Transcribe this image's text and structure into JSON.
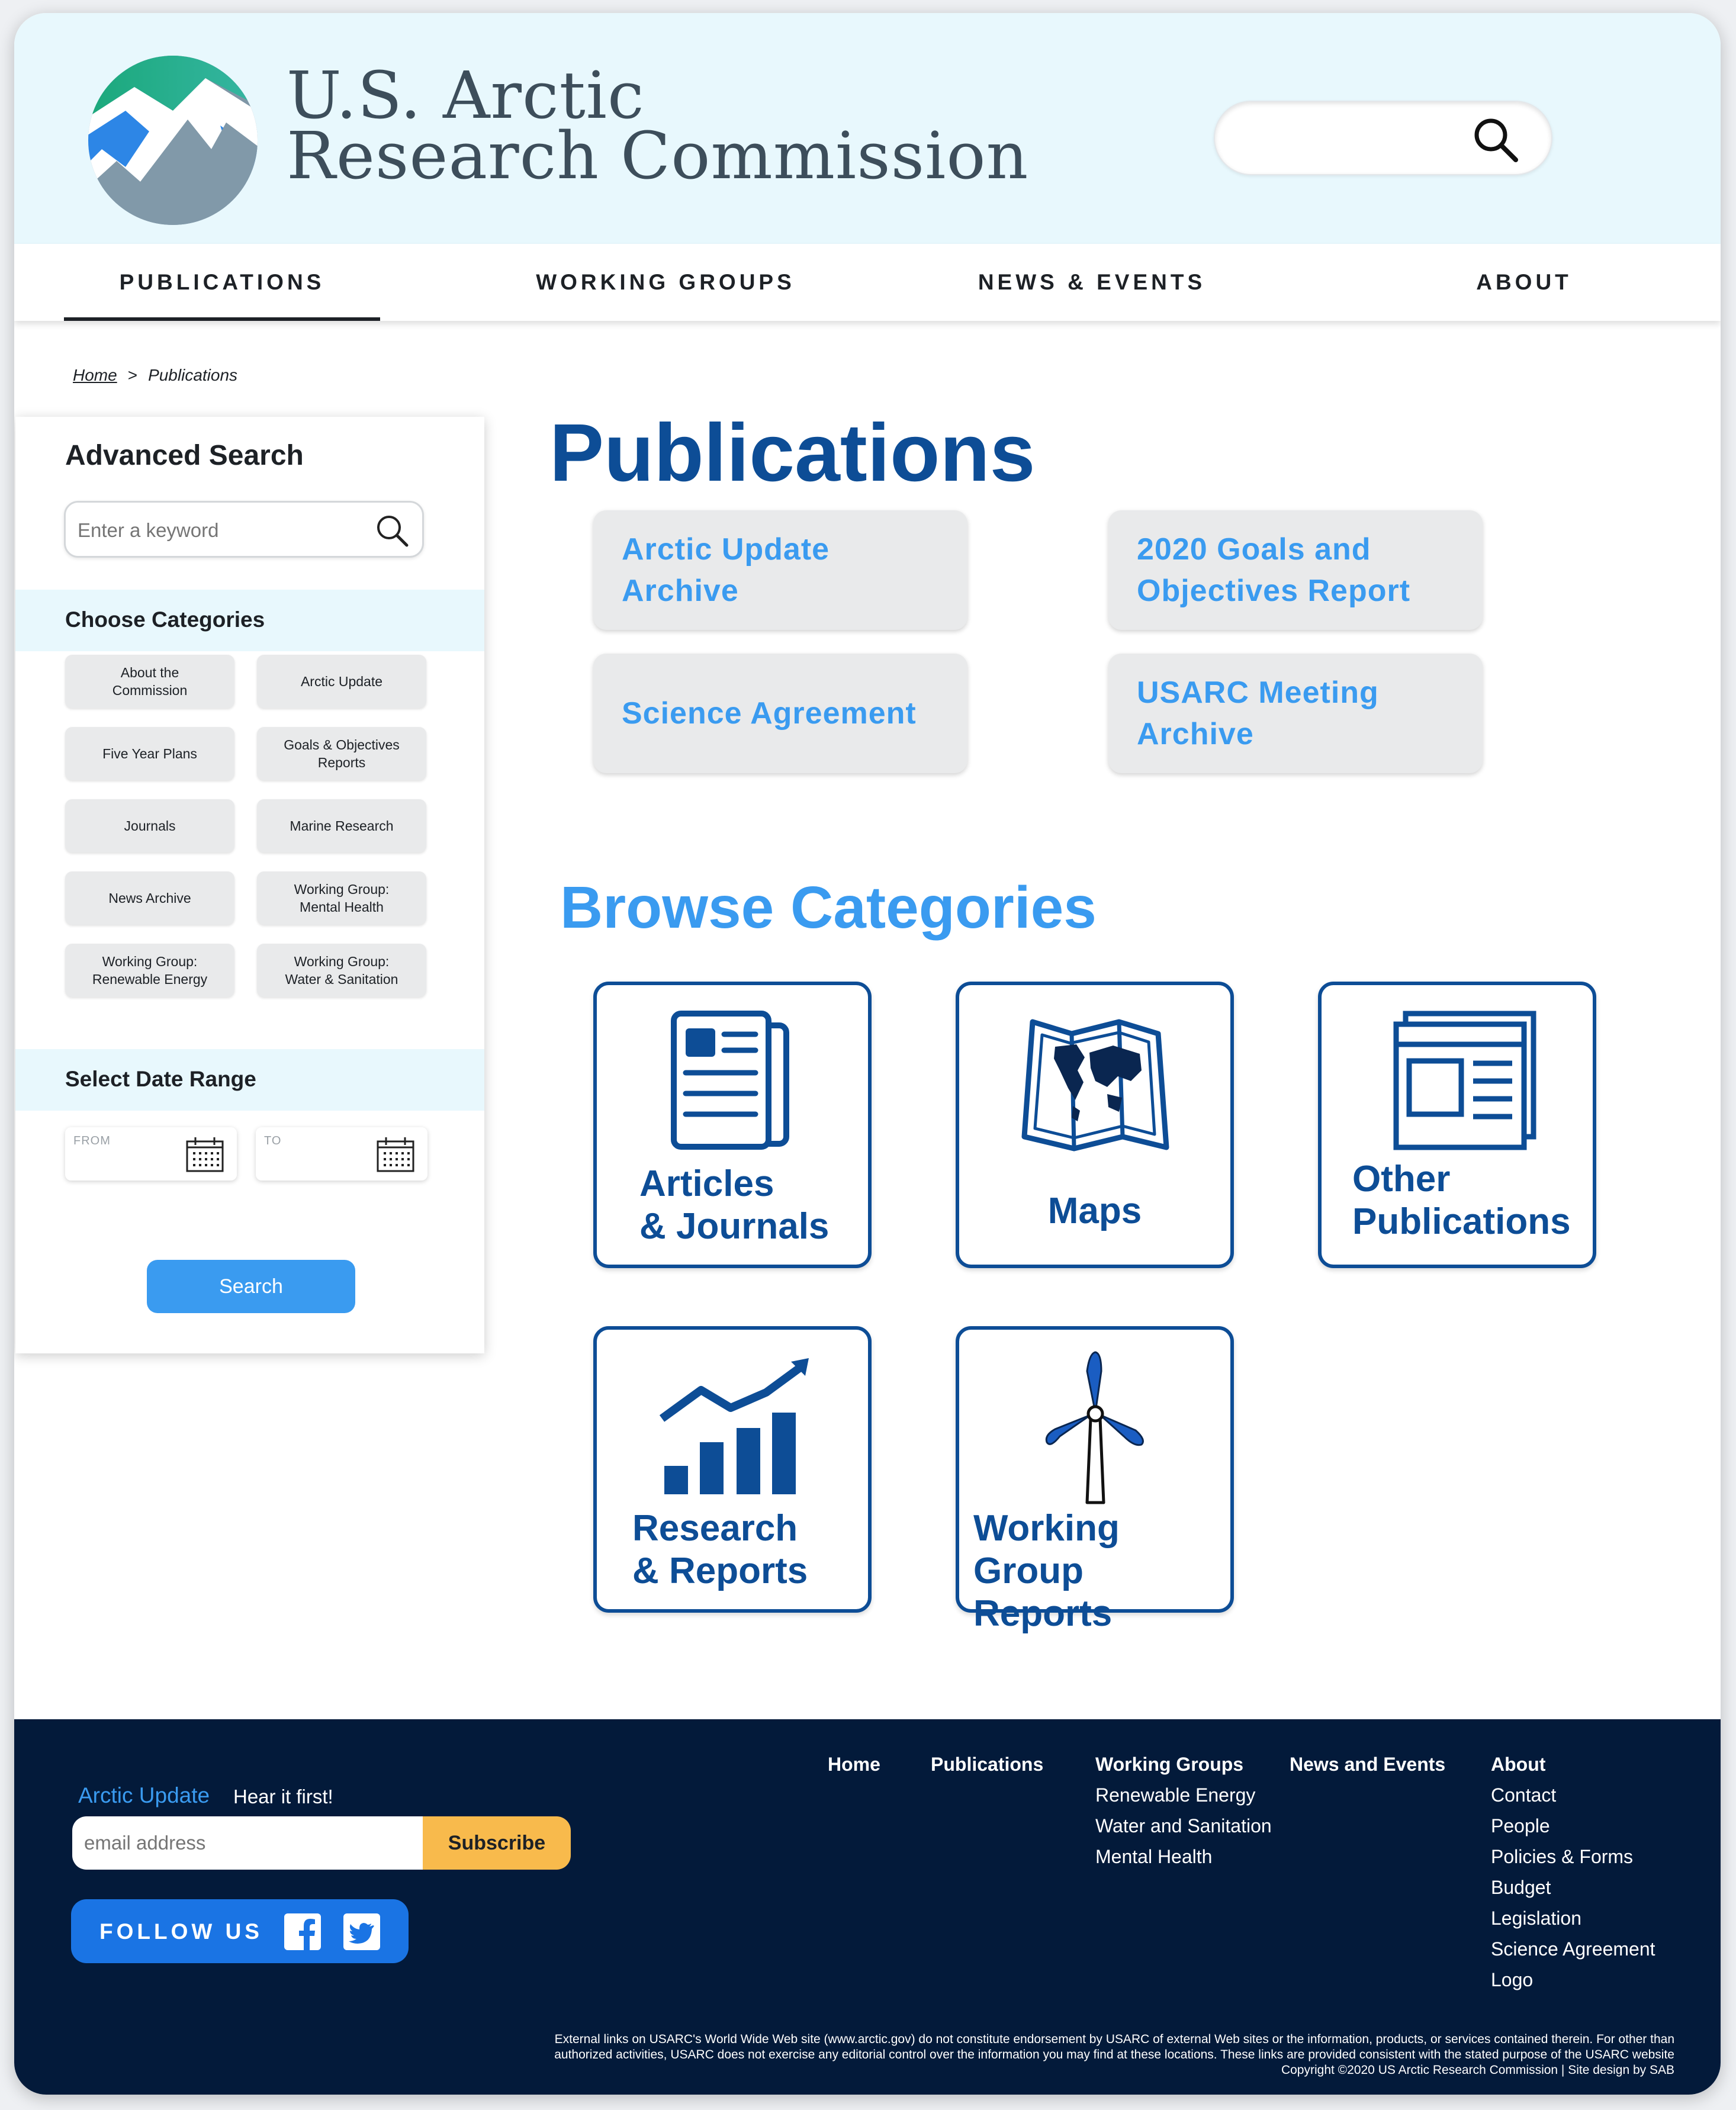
{
  "header": {
    "title_line1": "U.S. Arctic",
    "title_line2": "Research Commission",
    "search_placeholder": ""
  },
  "nav": {
    "items": [
      "PUBLICATIONS",
      "WORKING GROUPS",
      "NEWS & EVENTS",
      "ABOUT"
    ],
    "active": "PUBLICATIONS"
  },
  "breadcrumb": {
    "home": "Home",
    "separator": ">",
    "current": "Publications"
  },
  "sidebar": {
    "title": "Advanced Search",
    "keyword_placeholder": "Enter a keyword",
    "categories_title": "Choose Categories",
    "categories": [
      "About the\nCommission",
      "Arctic Update",
      "Five Year Plans",
      "Goals & Objectives\nReports",
      "Journals",
      "Marine Research",
      "News Archive",
      "Working Group:\nMental Health",
      "Working Group:\nRenewable Energy",
      "Working Group:\nWater & Sanitation"
    ],
    "date_title": "Select Date Range",
    "from_label": "FROM",
    "to_label": "TO",
    "search_label": "Search"
  },
  "main": {
    "title": "Publications",
    "featured": [
      "Arctic Update\nArchive",
      "2020 Goals and\nObjectives Report",
      "Science Agreement",
      "USARC Meeting\nArchive"
    ],
    "browse_title": "Browse Categories",
    "browse": [
      {
        "label": "Articles\n& Journals",
        "icon": "newspaper-icon"
      },
      {
        "label": "Maps",
        "icon": "map-icon"
      },
      {
        "label": "Other\nPublications",
        "icon": "publication-icon"
      },
      {
        "label": "Research\n& Reports",
        "icon": "bar-chart-icon"
      },
      {
        "label": "Working\nGroup Reports",
        "icon": "wind-turbine-icon"
      }
    ]
  },
  "footer": {
    "arctic_update": "Arctic Update",
    "tagline": "Hear it first!",
    "email_placeholder": "email address",
    "subscribe": "Subscribe",
    "follow": "FOLLOW US",
    "col_home": "Home",
    "col_publications": "Publications",
    "col_working_groups": "Working Groups",
    "working_groups_links": [
      "Renewable Energy",
      "Water and Sanitation",
      "Mental Health"
    ],
    "col_news": "News and Events",
    "col_about": "About",
    "about_links": [
      "Contact",
      "People",
      "Policies  & Forms",
      "Budget",
      "Legislation",
      "Science Agreement",
      "Logo"
    ],
    "legal_1": "External links on USARC's World Wide Web site (www.arctic.gov) do not constitute endorsement by USARC of external Web sites or the information, products, or services contained therein. For other than",
    "legal_2": "authorized activities, USARC does not exercise any editorial control over the information you may find at these locations. These links are provided consistent with the stated purpose of the USARC website",
    "legal_3": "Copyright ©2020 US Arctic Research Commission | Site design by SAB"
  },
  "colors": {
    "header_bg": "#e8f8fd",
    "primary_dark": "#0d4d96",
    "accent": "#3a9bf0",
    "footer_bg": "#031a3a",
    "subscribe": "#f8ba4c",
    "follow_bg": "#1a74e4"
  }
}
